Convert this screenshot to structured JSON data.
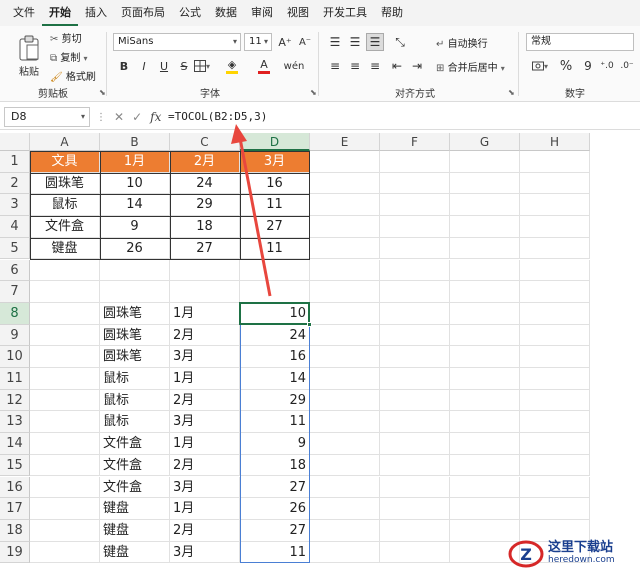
{
  "menubar": {
    "items": [
      "文件",
      "开始",
      "插入",
      "页面布局",
      "公式",
      "数据",
      "审阅",
      "视图",
      "开发工具",
      "帮助"
    ],
    "active_index": 1
  },
  "ribbon": {
    "clipboard": {
      "paste": "粘贴",
      "cut": "剪切",
      "copy": "复制",
      "format_painter": "格式刷",
      "label": "剪贴板"
    },
    "font": {
      "name": "MiSans",
      "size": "11",
      "bold": "B",
      "italic": "I",
      "underline": "U",
      "strike": "S",
      "grow": "A⁺",
      "shrink": "A⁻",
      "label": "字体",
      "fill_color": "#ffd400",
      "font_color": "#e02020"
    },
    "alignment": {
      "wrap": "自动换行",
      "merge": "合并后居中",
      "label": "对齐方式"
    },
    "number": {
      "format": "常规",
      "percent": "%",
      "comma": "9",
      "label": "数字"
    }
  },
  "formula_bar": {
    "name_box": "D8",
    "cancel": "✕",
    "enter": "✓",
    "fx": "fx",
    "formula": "=TOCOL(B2:D5,3)"
  },
  "grid": {
    "columns": [
      "A",
      "B",
      "C",
      "D",
      "E",
      "F",
      "G",
      "H"
    ],
    "rows": [
      "1",
      "2",
      "3",
      "4",
      "5",
      "6",
      "7",
      "8",
      "9",
      "10",
      "11",
      "12",
      "13",
      "14",
      "15",
      "16",
      "17",
      "18",
      "19"
    ],
    "selected_column": "D",
    "selected_row": "8",
    "table_header": [
      "文具",
      "1月",
      "2月",
      "3月"
    ],
    "table_rows": [
      [
        "圆珠笔",
        "10",
        "24",
        "16"
      ],
      [
        "鼠标",
        "14",
        "29",
        "11"
      ],
      [
        "文件盒",
        "9",
        "18",
        "27"
      ],
      [
        "键盘",
        "26",
        "27",
        "11"
      ]
    ],
    "result_rows": [
      [
        "圆珠笔",
        "1月",
        "10"
      ],
      [
        "圆珠笔",
        "2月",
        "24"
      ],
      [
        "圆珠笔",
        "3月",
        "16"
      ],
      [
        "鼠标",
        "1月",
        "14"
      ],
      [
        "鼠标",
        "2月",
        "29"
      ],
      [
        "鼠标",
        "3月",
        "11"
      ],
      [
        "文件盒",
        "1月",
        "9"
      ],
      [
        "文件盒",
        "2月",
        "18"
      ],
      [
        "文件盒",
        "3月",
        "27"
      ],
      [
        "键盘",
        "1月",
        "26"
      ],
      [
        "键盘",
        "2月",
        "27"
      ],
      [
        "键盘",
        "3月",
        "11"
      ]
    ],
    "header_fill": "#ed7d31",
    "accent": "#1e7145"
  },
  "annotation": {
    "arrow_color": "#e8473e"
  },
  "watermark": {
    "cn": "这里下载站",
    "en": "heredown.com"
  }
}
